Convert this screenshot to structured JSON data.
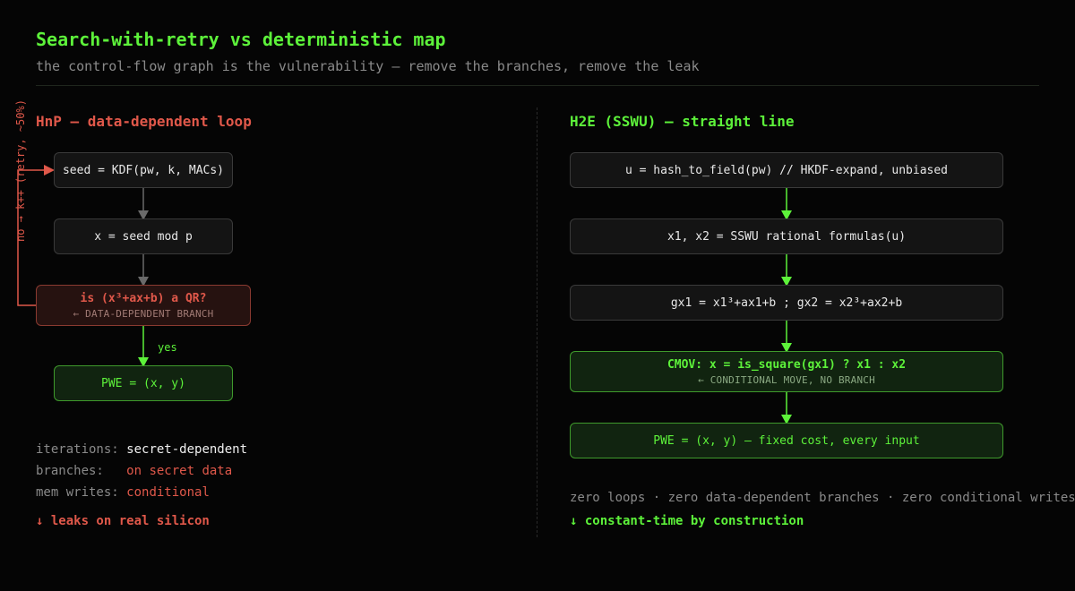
{
  "header": {
    "title": "Search-with-retry vs deterministic map",
    "subtitle": "the control-flow graph is the vulnerability — remove the branches, remove the leak"
  },
  "left": {
    "heading": "HnP — data-dependent loop",
    "retry_label": "no → k++ (retry, ~50%)",
    "yes_label": "yes",
    "steps": {
      "seed": "seed = KDF(pw, k, MACs)",
      "mod": "x = seed mod p",
      "qr_main": "is (x³+ax+b) a QR?",
      "qr_sub": "← DATA-DEPENDENT BRANCH",
      "pwe": "PWE = (x, y)"
    },
    "stats": [
      {
        "key": "iterations: ",
        "value": "secret-dependent",
        "tone": "white"
      },
      {
        "key": "branches:   ",
        "value": "on secret data",
        "tone": "red"
      },
      {
        "key": "mem writes: ",
        "value": "conditional",
        "tone": "red"
      }
    ],
    "footer": "↓ leaks on real silicon"
  },
  "right": {
    "heading": "H2E (SSWU) — straight line",
    "steps": {
      "hash": "u = hash_to_field(pw) // HKDF-expand, unbiased",
      "sswu": "x1, x2 = SSWU rational formulas(u)",
      "gx": "gx1 = x1³+ax1+b ; gx2 = x2³+ax2+b",
      "cmov_main": "CMOV: x = is_square(gx1) ? x1 : x2",
      "cmov_sub": "← CONDITIONAL MOVE, NO BRANCH",
      "pwe": "PWE = (x, y) — fixed cost, every input"
    },
    "summary": "zero loops · zero data-dependent branches · zero conditional writes",
    "footer": "↓ constant-time by construction"
  },
  "colors": {
    "accent_green": "#5df23a",
    "accent_red": "#e0584a",
    "muted": "#8a8a8a",
    "background": "#050505"
  }
}
